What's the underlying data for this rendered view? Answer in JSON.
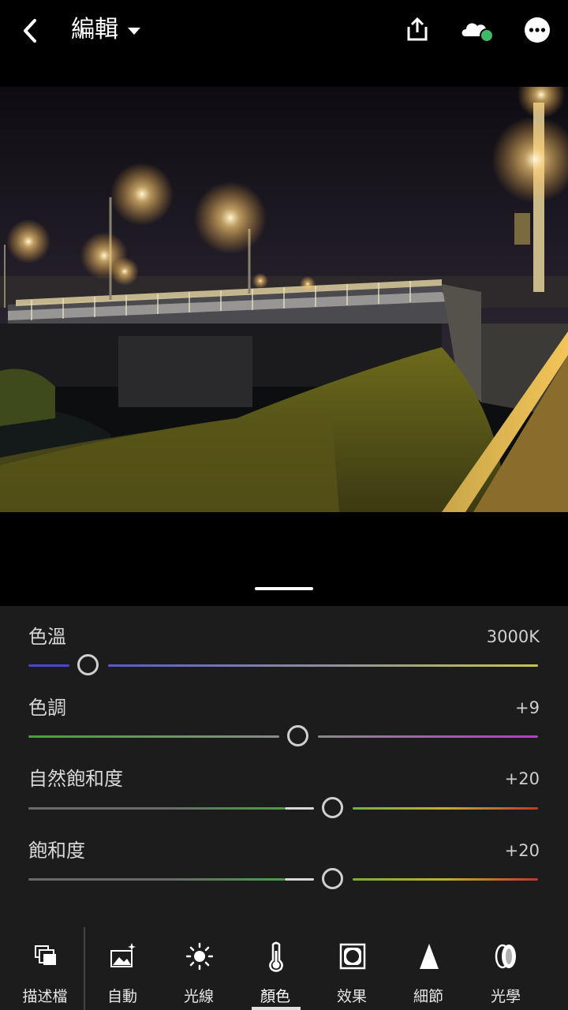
{
  "header": {
    "title": "編輯"
  },
  "sliders": [
    {
      "label": "色溫",
      "value": "3000K",
      "position": 0.13
    },
    {
      "label": "色調",
      "value": "+9",
      "position": 0.53
    },
    {
      "label": "自然飽和度",
      "value": "+20",
      "position": 0.6
    },
    {
      "label": "飽和度",
      "value": "+20",
      "position": 0.6
    }
  ],
  "toolbar": {
    "items": [
      {
        "label": "描述檔",
        "icon": "profiles-icon"
      },
      {
        "label": "自動",
        "icon": "auto-icon"
      },
      {
        "label": "光線",
        "icon": "light-icon"
      },
      {
        "label": "顏色",
        "icon": "color-icon",
        "active": true
      },
      {
        "label": "效果",
        "icon": "effects-icon"
      },
      {
        "label": "細節",
        "icon": "detail-icon"
      },
      {
        "label": "光學",
        "icon": "optics-icon"
      }
    ]
  },
  "colors": {
    "sync_status": "#3fb868",
    "panel_bg": "#1c1c1c"
  }
}
